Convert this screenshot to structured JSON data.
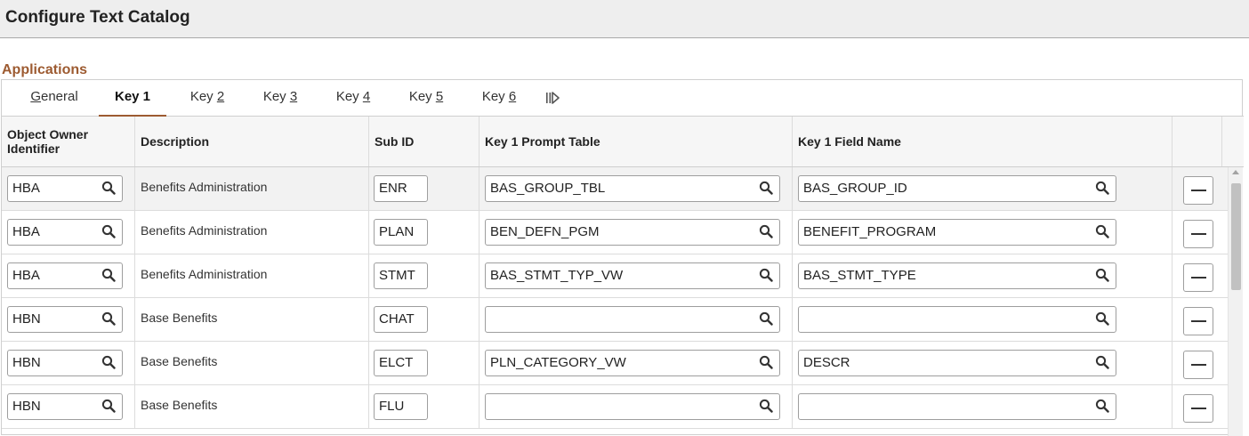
{
  "page": {
    "title": "Configure Text Catalog"
  },
  "section": {
    "title": "Applications"
  },
  "tabs": [
    {
      "pre": "",
      "key": "G",
      "post": "eneral"
    },
    {
      "pre": "Key 1",
      "key": "",
      "post": ""
    },
    {
      "pre": "Key ",
      "key": "2",
      "post": ""
    },
    {
      "pre": "Key ",
      "key": "3",
      "post": ""
    },
    {
      "pre": "Key ",
      "key": "4",
      "post": ""
    },
    {
      "pre": "Key ",
      "key": "5",
      "post": ""
    },
    {
      "pre": "Key ",
      "key": "6",
      "post": ""
    }
  ],
  "active_tab": "Key 1",
  "more_tabs_icon": "show-all-columns-icon",
  "columns": {
    "owner": "Object Owner Identifier",
    "description": "Description",
    "subid": "Sub ID",
    "prompt": "Key 1 Prompt Table",
    "field": "Key 1 Field Name"
  },
  "rows": [
    {
      "owner": "HBA",
      "description": "Benefits Administration",
      "subid": "ENR",
      "prompt": "BAS_GROUP_TBL",
      "field": "BAS_GROUP_ID"
    },
    {
      "owner": "HBA",
      "description": "Benefits Administration",
      "subid": "PLAN",
      "prompt": "BEN_DEFN_PGM",
      "field": "BENEFIT_PROGRAM"
    },
    {
      "owner": "HBA",
      "description": "Benefits Administration",
      "subid": "STMT",
      "prompt": "BAS_STMT_TYP_VW",
      "field": "BAS_STMT_TYPE"
    },
    {
      "owner": "HBN",
      "description": "Base Benefits",
      "subid": "CHAT",
      "prompt": "",
      "field": ""
    },
    {
      "owner": "HBN",
      "description": "Base Benefits",
      "subid": "ELCT",
      "prompt": "PLN_CATEGORY_VW",
      "field": "DESCR"
    },
    {
      "owner": "HBN",
      "description": "Base Benefits",
      "subid": "FLU",
      "prompt": "",
      "field": ""
    }
  ],
  "icons": {
    "lookup": "search-icon",
    "delete_row": "minus-icon"
  },
  "colors": {
    "accent": "#9d5b31",
    "header_bg": "#eeeeee",
    "selected_row": "#f2f2f2"
  }
}
